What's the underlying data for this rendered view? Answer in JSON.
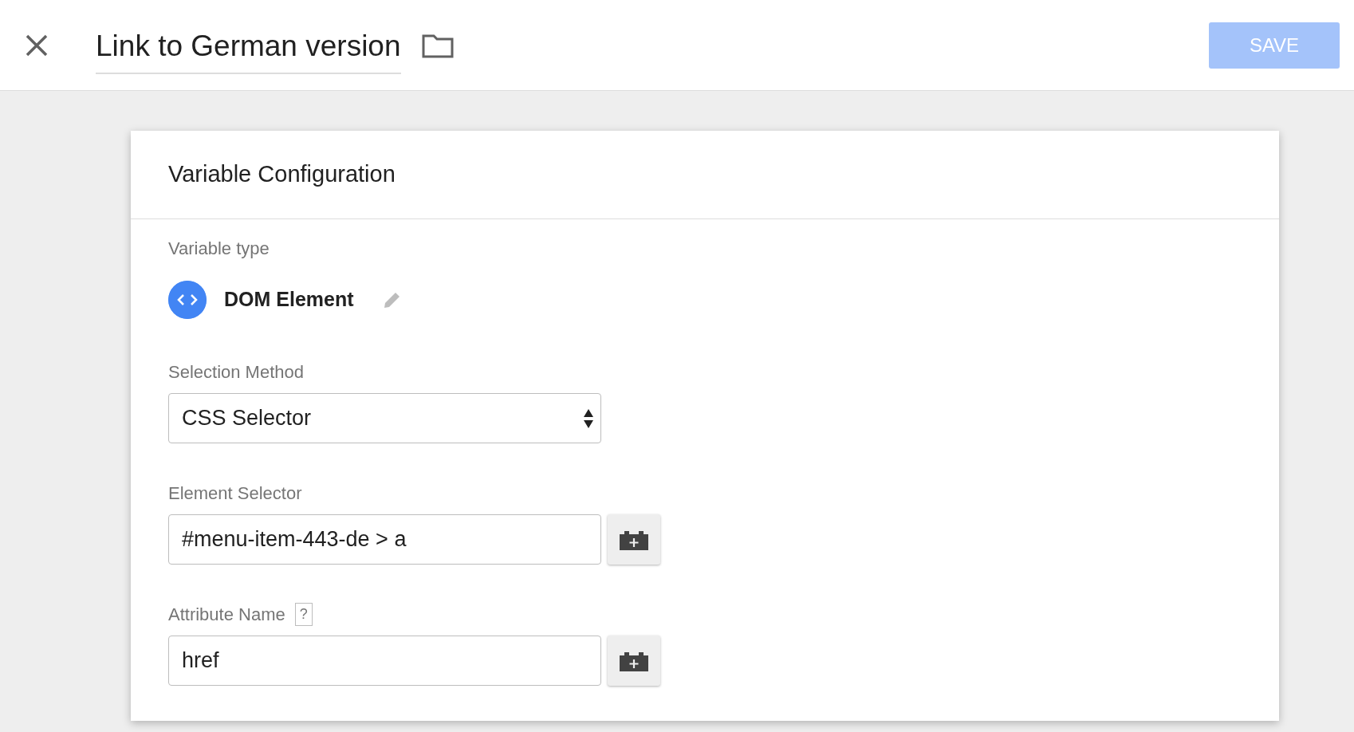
{
  "header": {
    "title": "Link to German version",
    "save_button": {
      "label": "SAVE",
      "disabled": true
    }
  },
  "card": {
    "title": "Variable Configuration",
    "variable_type": {
      "label": "Variable type",
      "value": "DOM Element"
    },
    "fields": [
      {
        "kind": "select",
        "label": "Selection Method",
        "value": "CSS Selector"
      },
      {
        "kind": "text",
        "label": "Element Selector",
        "value": "#menu-item-443-de > a"
      },
      {
        "kind": "text",
        "label": "Attribute Name",
        "help": "?",
        "value": "href"
      }
    ]
  }
}
